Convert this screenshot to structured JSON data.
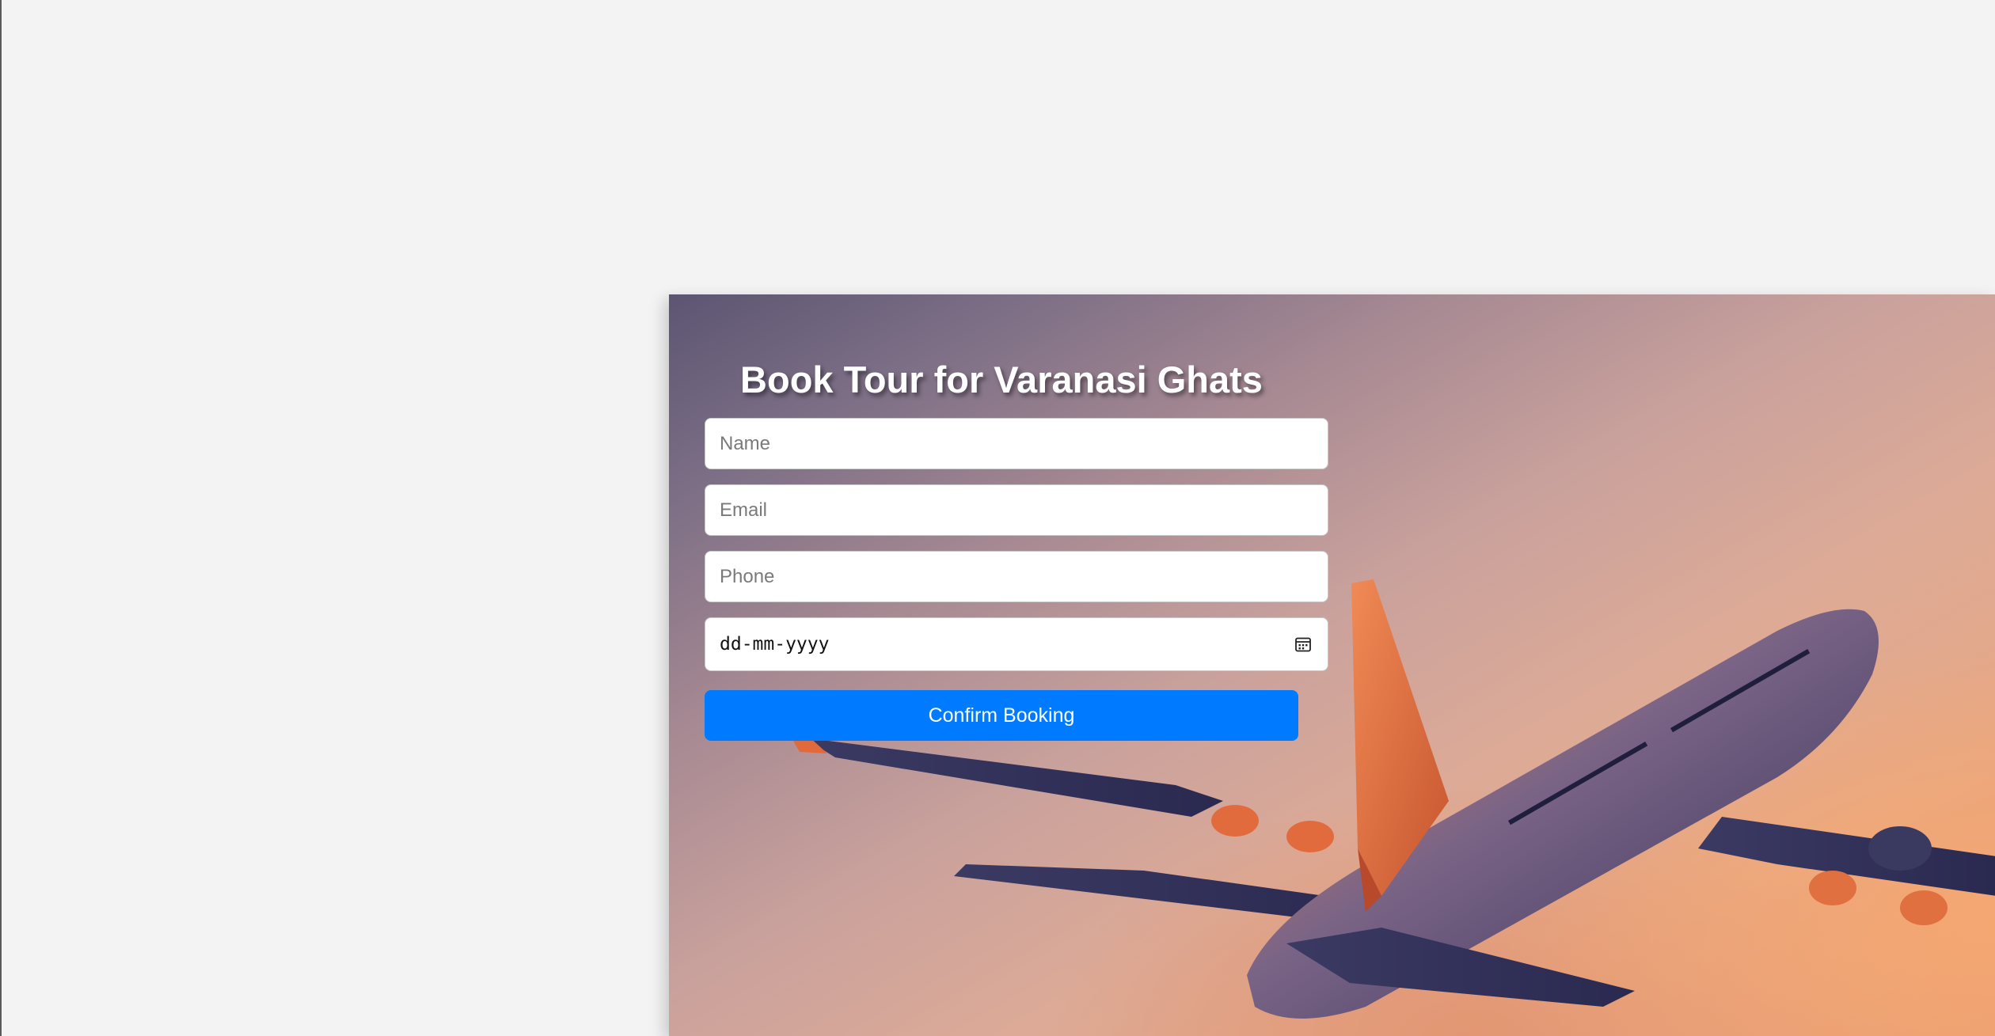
{
  "booking_form": {
    "title": "Book Tour for Varanasi Ghats",
    "name_placeholder": "Name",
    "email_placeholder": "Email",
    "phone_placeholder": "Phone",
    "date_placeholder": "dd-mm-yyyy",
    "submit_label": "Confirm Booking"
  },
  "icons": {
    "date_picker": "calendar-icon"
  },
  "colors": {
    "page_background": "#f3f3f3",
    "button_background": "#007bff",
    "button_text": "#ffffff",
    "title_text": "#ffffff"
  }
}
